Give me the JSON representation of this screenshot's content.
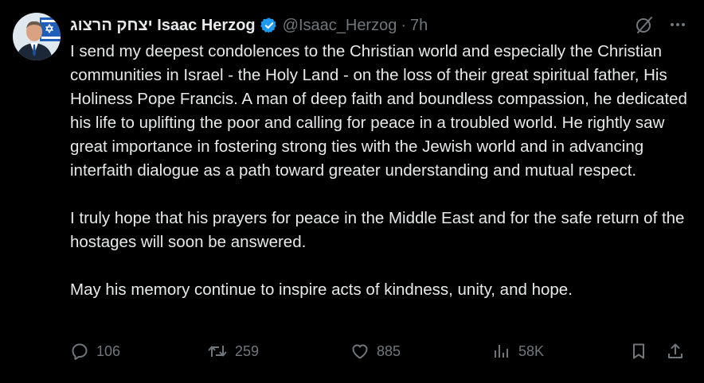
{
  "author": {
    "display_name": "יצחק הרצוג Isaac Herzog",
    "handle": "@Isaac_Herzog",
    "separator": "·",
    "time": "7h",
    "verified": true,
    "avatar": "portrait-with-israeli-flag"
  },
  "tweet": {
    "paragraphs": [
      "I send my deepest condolences to the Christian world and especially the Christian communities in Israel - the Holy Land - on the loss of their great spiritual father, His Holiness Pope Francis. A man of deep faith and boundless compassion, he dedicated his life to uplifting the poor and calling for peace in a troubled world. He rightly saw great importance in fostering strong ties with the Jewish world and in advancing interfaith dialogue as a path toward greater understanding and mutual respect.",
      "I truly hope that his prayers for peace in the Middle East and for the safe return of the hostages will soon be answered.",
      "May his memory continue to inspire acts of kindness, unity, and hope."
    ]
  },
  "actions": {
    "replies": "106",
    "reposts": "259",
    "likes": "885",
    "views": "58K"
  },
  "icons": {
    "grok": "grok-icon",
    "more": "more-icon",
    "reply": "reply-icon",
    "repost": "repost-icon",
    "like": "like-icon",
    "views": "views-icon",
    "bookmark": "bookmark-icon",
    "share": "share-icon"
  },
  "colors": {
    "background": "#000000",
    "text": "#e7e9ea",
    "secondary": "#71767b",
    "verified": "#1d9bf0"
  }
}
